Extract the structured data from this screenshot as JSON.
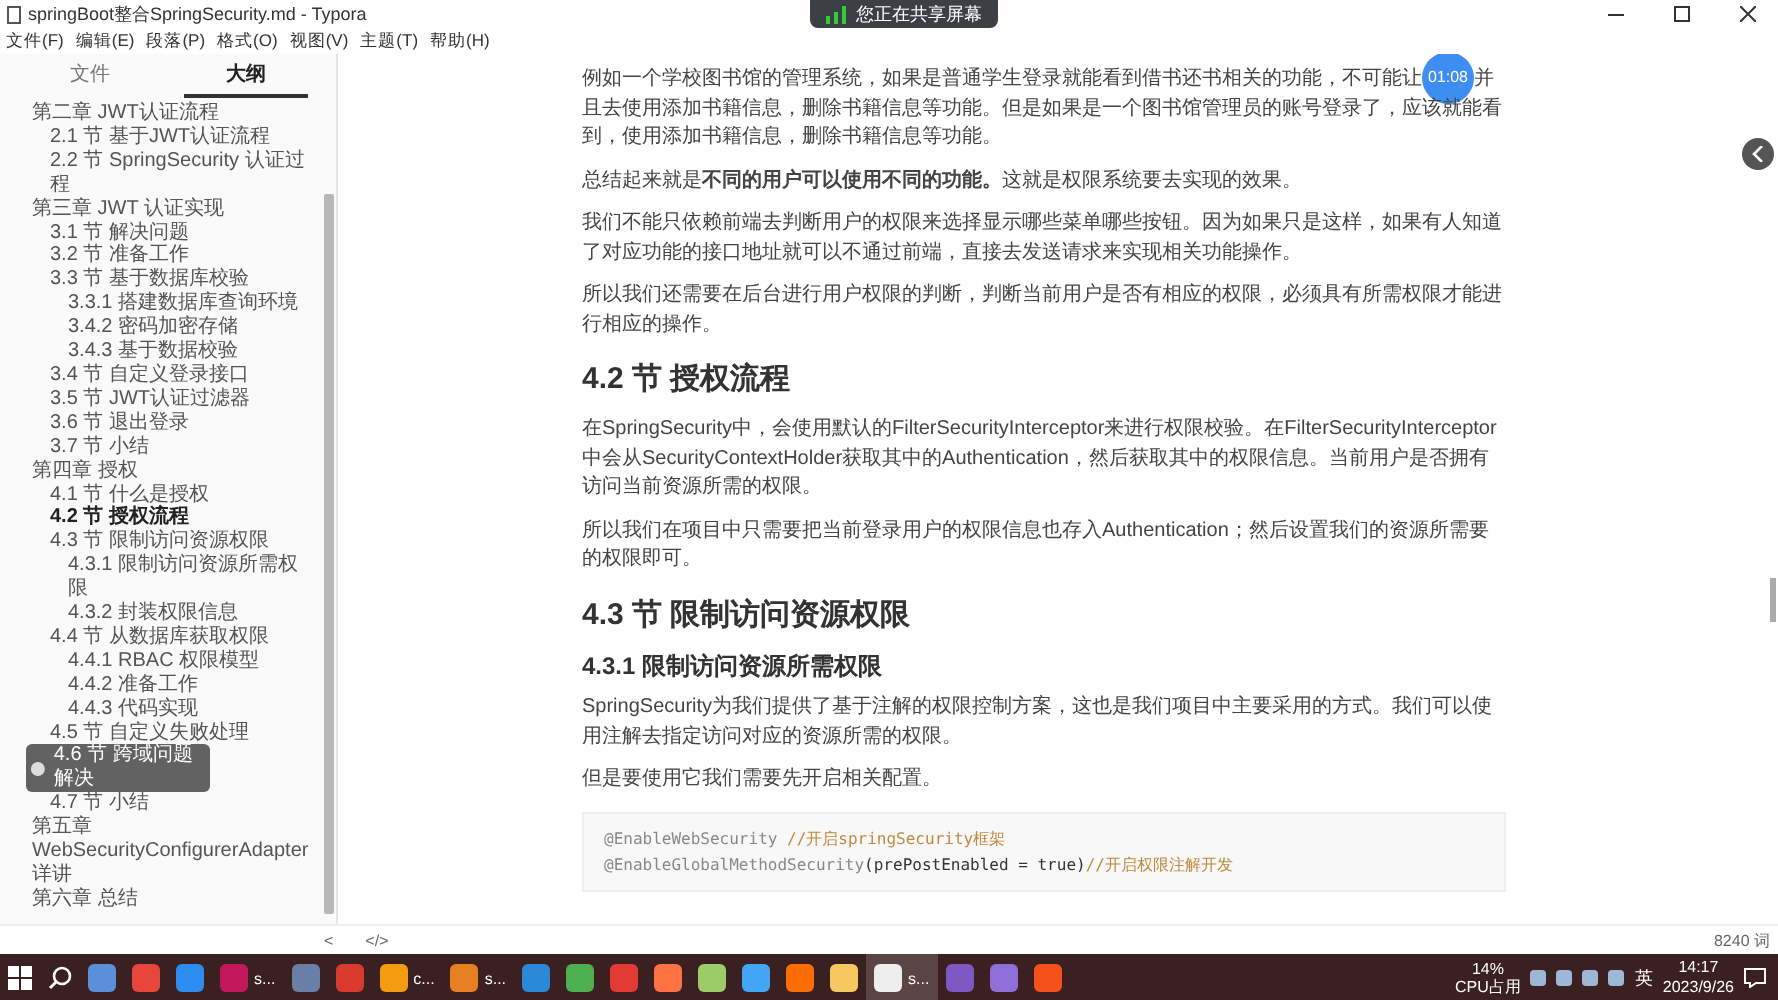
{
  "window": {
    "title": "springBoot整合SpringSecurity.md - Typora"
  },
  "share_banner": {
    "text": "您正在共享屏幕"
  },
  "menu": [
    "文件(F)",
    "编辑(E)",
    "段落(P)",
    "格式(O)",
    "视图(V)",
    "主题(T)",
    "帮助(H)"
  ],
  "sidebar": {
    "tabs": [
      {
        "label": "文件",
        "selected": false
      },
      {
        "label": "大纲",
        "selected": true
      }
    ],
    "outline": [
      {
        "label": "第二章 JWT认证流程",
        "selected": false,
        "children": [
          {
            "label": "2.1 节 基于JWT认证流程",
            "selected": false
          },
          {
            "label": "2.2 节 SpringSecurity 认证过程",
            "selected": false
          }
        ]
      },
      {
        "label": "第三章 JWT 认证实现",
        "selected": false,
        "children": [
          {
            "label": "3.1 节 解决问题",
            "selected": false
          },
          {
            "label": "3.2 节 准备工作",
            "selected": false
          },
          {
            "label": "3.3 节 基于数据库校验",
            "selected": false,
            "children": [
              {
                "label": "3.3.1 搭建数据库查询环境",
                "selected": false
              },
              {
                "label": "3.4.2 密码加密存储",
                "selected": false
              },
              {
                "label": "3.4.3 基于数据校验",
                "selected": false
              }
            ]
          },
          {
            "label": "3.4 节 自定义登录接口",
            "selected": false
          },
          {
            "label": "3.5 节 JWT认证过滤器",
            "selected": false
          },
          {
            "label": "3.6 节 退出登录",
            "selected": false
          },
          {
            "label": "3.7 节 小结",
            "selected": false
          }
        ]
      },
      {
        "label": "第四章 授权",
        "selected": false,
        "children": [
          {
            "label": "4.1 节 什么是授权",
            "selected": false
          },
          {
            "label": "4.2 节 授权流程",
            "selected": true
          },
          {
            "label": "4.3 节 限制访问资源权限",
            "selected": false,
            "children": [
              {
                "label": "4.3.1 限制访问资源所需权限",
                "selected": false
              },
              {
                "label": "4.3.2 封装权限信息",
                "selected": false
              }
            ]
          },
          {
            "label": "4.4 节 从数据库获取权限",
            "selected": false,
            "children": [
              {
                "label": "4.4.1 RBAC 权限模型",
                "selected": false
              },
              {
                "label": "4.4.2 准备工作",
                "selected": false
              },
              {
                "label": "4.4.3 代码实现",
                "selected": false
              }
            ]
          },
          {
            "label": "4.5 节 自定义失败处理",
            "selected": false
          },
          {
            "label": "4.6 节 跨域问题解决",
            "selected": false,
            "toast": true
          },
          {
            "label": "4.7 节 小结",
            "selected": false
          }
        ]
      },
      {
        "label": "第五章 WebSecurityConfigurerAdapter 详讲",
        "selected": false
      },
      {
        "label": "第六章 总结",
        "selected": false
      }
    ]
  },
  "document": {
    "blocks": [
      {
        "kind": "timer_paragraph",
        "before": "例如一个学校图书馆的管理系统，如果是普通学生登录就能看到借书还书相关的功能，不可能让",
        "timer": "01:08",
        "after": "并且去使用添加书籍信息，删除书籍信息等功能。但是如果是一个图书馆管理员的账号登录了，应该就能看到，使用添加书籍信息，删除书籍信息等功能。"
      },
      {
        "kind": "paragraph",
        "text": "总结起来就是**不同的用户可以使用不同的功能。**这就是权限系统要去实现的效果。"
      },
      {
        "kind": "paragraph",
        "text": "我们不能只依赖前端去判断用户的权限来选择显示哪些菜单哪些按钮。因为如果只是这样，如果有人知道了对应功能的接口地址就可以不通过前端，直接去发送请求来实现相关功能操作。"
      },
      {
        "kind": "paragraph",
        "text": "所以我们还需要在后台进行用户权限的判断，判断当前用户是否有相应的权限，必须具有所需权限才能进行相应的操作。"
      },
      {
        "kind": "h2",
        "text": "4.2 节 授权流程"
      },
      {
        "kind": "paragraph",
        "text": "在SpringSecurity中，会使用默认的FilterSecurityInterceptor来进行权限校验。在FilterSecurityInterceptor中会从SecurityContextHolder获取其中的Authentication，然后获取其中的权限信息。当前用户是否拥有访问当前资源所需的权限。"
      },
      {
        "kind": "paragraph",
        "text": "所以我们在项目中只需要把当前登录用户的权限信息也存入Authentication；然后设置我们的资源所需要的权限即可。"
      },
      {
        "kind": "h2",
        "text": "4.3 节 限制访问资源权限"
      },
      {
        "kind": "h3",
        "text": "4.3.1 限制访问资源所需权限"
      },
      {
        "kind": "paragraph",
        "text": "SpringSecurity为我们提供了基于注解的权限控制方案，这也是我们项目中主要采用的方式。我们可以使用注解去指定访问对应的资源所需的权限。"
      },
      {
        "kind": "paragraph",
        "text": "但是要使用它我们需要先开启相关配置。"
      },
      {
        "kind": "code",
        "lines": [
          [
            {
              "kind": "annotation",
              "text": "@EnableWebSecurity "
            },
            {
              "kind": "comment",
              "text": "//开启springSecurity框架"
            }
          ],
          [
            {
              "kind": "annotation",
              "text": "@EnableGlobalMethodSecurity"
            },
            {
              "kind": "plain",
              "text": "(prePostEnabled = true)"
            },
            {
              "kind": "comment",
              "text": "//开启权限注解开发"
            }
          ]
        ]
      }
    ]
  },
  "status_bar": {
    "left": [
      "<",
      "</>"
    ],
    "word_count": "8240 词"
  },
  "taskbar": {
    "apps": [
      {
        "color": "#5b8fd8",
        "selected": false
      },
      {
        "color": "#e8453c",
        "selected": false
      },
      {
        "color": "#2d8cf0",
        "selected": false
      },
      {
        "color": "#c2185b",
        "label": "s...",
        "selected": false
      },
      {
        "color": "#6a7fa8",
        "selected": false
      },
      {
        "color": "#d83a2e",
        "selected": false
      },
      {
        "color": "#f39c12",
        "label": "c...",
        "selected": false
      },
      {
        "color": "#e67e22",
        "label": "s...",
        "selected": false
      },
      {
        "color": "#2b88d8",
        "selected": false
      },
      {
        "color": "#4caf50",
        "selected": false
      },
      {
        "color": "#e53935",
        "selected": false
      },
      {
        "color": "#ff7043",
        "selected": false
      },
      {
        "color": "#9ccc65",
        "selected": false
      },
      {
        "color": "#42a5f5",
        "selected": false
      },
      {
        "color": "#ff6d00",
        "selected": false
      },
      {
        "color": "#f6c85f",
        "selected": false
      },
      {
        "color": "#eeeeee",
        "label": "s...",
        "selected": true
      },
      {
        "color": "#7e57c2",
        "selected": false
      },
      {
        "color": "#8e6fd8",
        "selected": false
      },
      {
        "color": "#f4511e",
        "selected": false
      }
    ],
    "cpu": [
      "14%",
      "CPU占用"
    ],
    "ime": "英",
    "time": "14:17",
    "date": "2023/9/26"
  }
}
